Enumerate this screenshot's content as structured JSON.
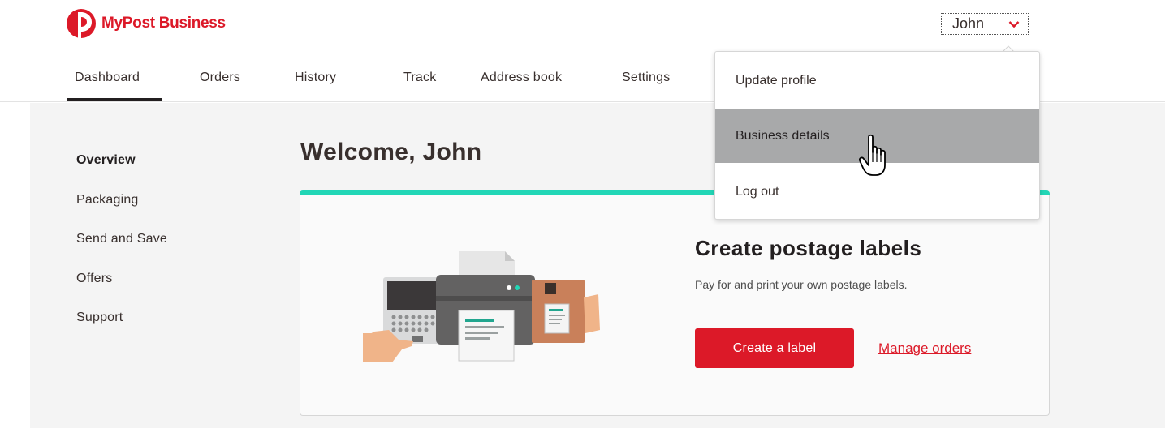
{
  "brand": {
    "name": "MyPost Business",
    "color": "#dc1928"
  },
  "user_menu": {
    "label": "John"
  },
  "nav": {
    "items": [
      {
        "label": "Dashboard",
        "active": true
      },
      {
        "label": "Orders"
      },
      {
        "label": "History"
      },
      {
        "label": "Track"
      },
      {
        "label": "Address book"
      },
      {
        "label": "Settings"
      }
    ]
  },
  "sidebar": {
    "items": [
      {
        "label": "Overview",
        "active": true
      },
      {
        "label": "Packaging"
      },
      {
        "label": "Send and Save"
      },
      {
        "label": "Offers"
      },
      {
        "label": "Support"
      }
    ]
  },
  "main": {
    "welcome": "Welcome, John",
    "card": {
      "title": "Create postage labels",
      "subtitle": "Pay for and print your own postage labels.",
      "primary_button": "Create a label",
      "secondary_link": "Manage orders",
      "accent_color": "#22d6b6"
    }
  },
  "dropdown": {
    "items": [
      {
        "label": "Update profile"
      },
      {
        "label": "Business details",
        "hovered": true
      },
      {
        "label": "Log out"
      }
    ]
  },
  "icons": [
    "mypost-logo-icon",
    "chevron-down-icon",
    "printer-illustration",
    "hand-pointer-cursor-icon"
  ]
}
